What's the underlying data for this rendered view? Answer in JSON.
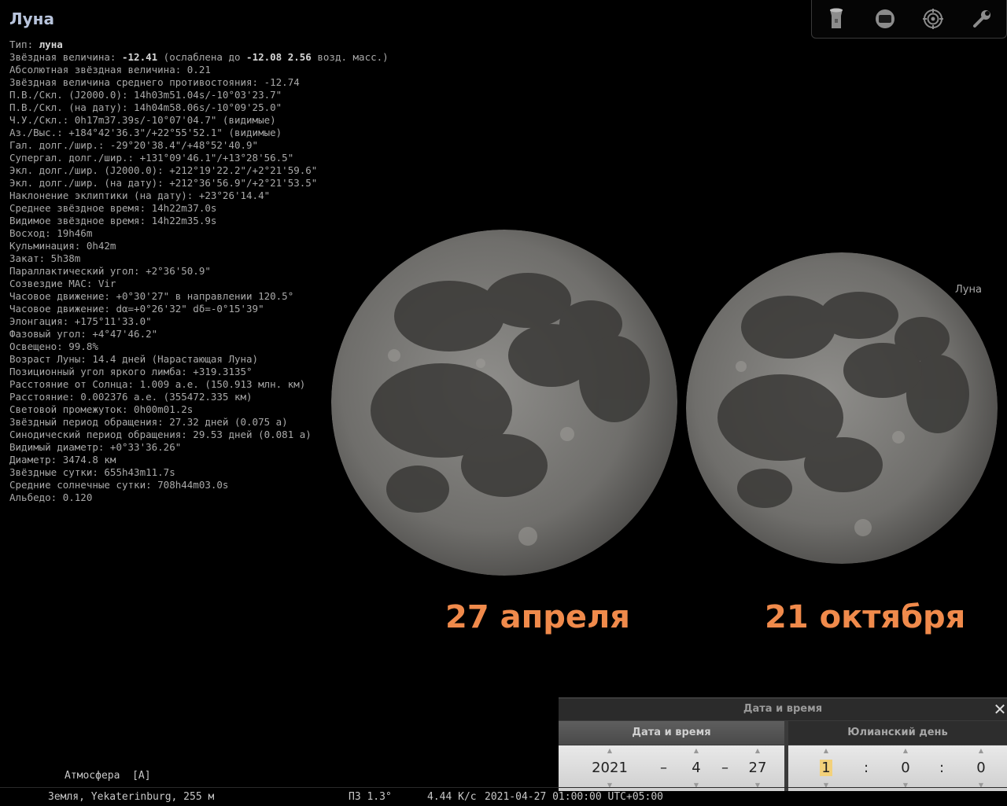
{
  "info": {
    "title": "Луна",
    "lines": [
      {
        "label": "Тип: ",
        "value": "луна"
      },
      {
        "label": "Звёздная величина: ",
        "value": "-12.41",
        "rest": " (ослаблена до ",
        "value2": "-12.08 2.56",
        "rest2": " возд. масс.)"
      },
      {
        "label": "Абсолютная звёздная величина: 0.21"
      },
      {
        "label": "Звёздная величина среднего противостояния: -12.74"
      },
      {
        "label": "П.В./Скл. (J2000.0): 14h03m51.04s/-10°03'23.7\""
      },
      {
        "label": "П.В./Скл. (на дату): 14h04m58.06s/-10°09'25.0\""
      },
      {
        "label": "Ч.У./Скл.: 0h17m37.39s/-10°07'04.7\" (видимые)"
      },
      {
        "label": "Аз./Выс.: +184°42'36.3\"/+22°55'52.1\" (видимые)"
      },
      {
        "label": "Гал. долг./шир.: -29°20'38.4\"/+48°52'40.9\""
      },
      {
        "label": "Супергал. долг./шир.: +131°09'46.1\"/+13°28'56.5\""
      },
      {
        "label": "Экл. долг./шир. (J2000.0): +212°19'22.2\"/+2°21'59.6\""
      },
      {
        "label": "Экл. долг./шир. (на дату): +212°36'56.9\"/+2°21'53.5\""
      },
      {
        "label": "Наклонение эклиптики (на дату): +23°26'14.4\""
      },
      {
        "label": "Среднее звёздное время: 14h22m37.0s"
      },
      {
        "label": "Видимое звёздное время: 14h22m35.9s"
      },
      {
        "label": "Восход: 19h46m"
      },
      {
        "label": "Кульминация: 0h42m"
      },
      {
        "label": "Закат: 5h38m"
      },
      {
        "label": "Параллактический угол: +2°36'50.9\""
      },
      {
        "label": "Созвездие МАС: Vir"
      },
      {
        "label": "Часовое движение: +0°30'27\" в направлении 120.5°"
      },
      {
        "label": "Часовое движение: dα=+0°26'32\" dδ=-0°15'39\""
      },
      {
        "label": "Элонгация: +175°11'33.0\""
      },
      {
        "label": "Фазовый угол: +4°47'46.2\""
      },
      {
        "label": "Освещено: 99.8%"
      },
      {
        "label": "Возраст Луны: 14.4 дней (Нарастающая Луна)"
      },
      {
        "label": "Позиционный угол яркого лимба: +319.3135°"
      },
      {
        "label": "Расстояние от Солнца: 1.009 а.е. (150.913 млн. км)"
      },
      {
        "label": "Расстояние: 0.002376 а.е. (355472.335 км)"
      },
      {
        "label": "Световой промежуток: 0h00m01.2s"
      },
      {
        "label": "Звёздный период обращения: 27.32 дней (0.075 а)"
      },
      {
        "label": "Синодический период обращения: 29.53 дней (0.081 а)"
      },
      {
        "label": "Видимый диаметр: +0°33'36.26\""
      },
      {
        "label": "Диаметр: 3474.8 км"
      },
      {
        "label": "Звёздные сутки: 655h43m11.7s"
      },
      {
        "label": "Средние солнечные сутки: 708h44m03.0s"
      },
      {
        "label": "Альбедо: 0.120"
      }
    ]
  },
  "toolbar": {
    "icons": [
      "flashlight-icon",
      "screen-icon",
      "target-icon",
      "wrench-icon"
    ]
  },
  "sky": {
    "moon_label": "Луна",
    "date_left": "27 апреля",
    "date_right": "21 октября"
  },
  "datetime_dialog": {
    "title": "Дата и время",
    "close": "✕",
    "tab_datetime": "Дата и время",
    "tab_julian": "Юлианский день",
    "year": "2021",
    "month": "4",
    "day": "27",
    "hour": "1",
    "minute": "0",
    "second": "0",
    "date_sep": "–",
    "time_sep": ":",
    "up_arrow": "▲",
    "down_arrow": "▼"
  },
  "status": {
    "atmosphere": "Атмосфера  [A]",
    "location": "Земля, Yekaterinburg, 255 м",
    "fov": "ПЗ 1.3°",
    "fps": "4.44 K/c",
    "datetime": "2021-04-27 01:00:00 UTC+05:00"
  },
  "colors": {
    "date_label": "#f08a4b",
    "title": "#b8c4dc",
    "background": "#000000"
  }
}
